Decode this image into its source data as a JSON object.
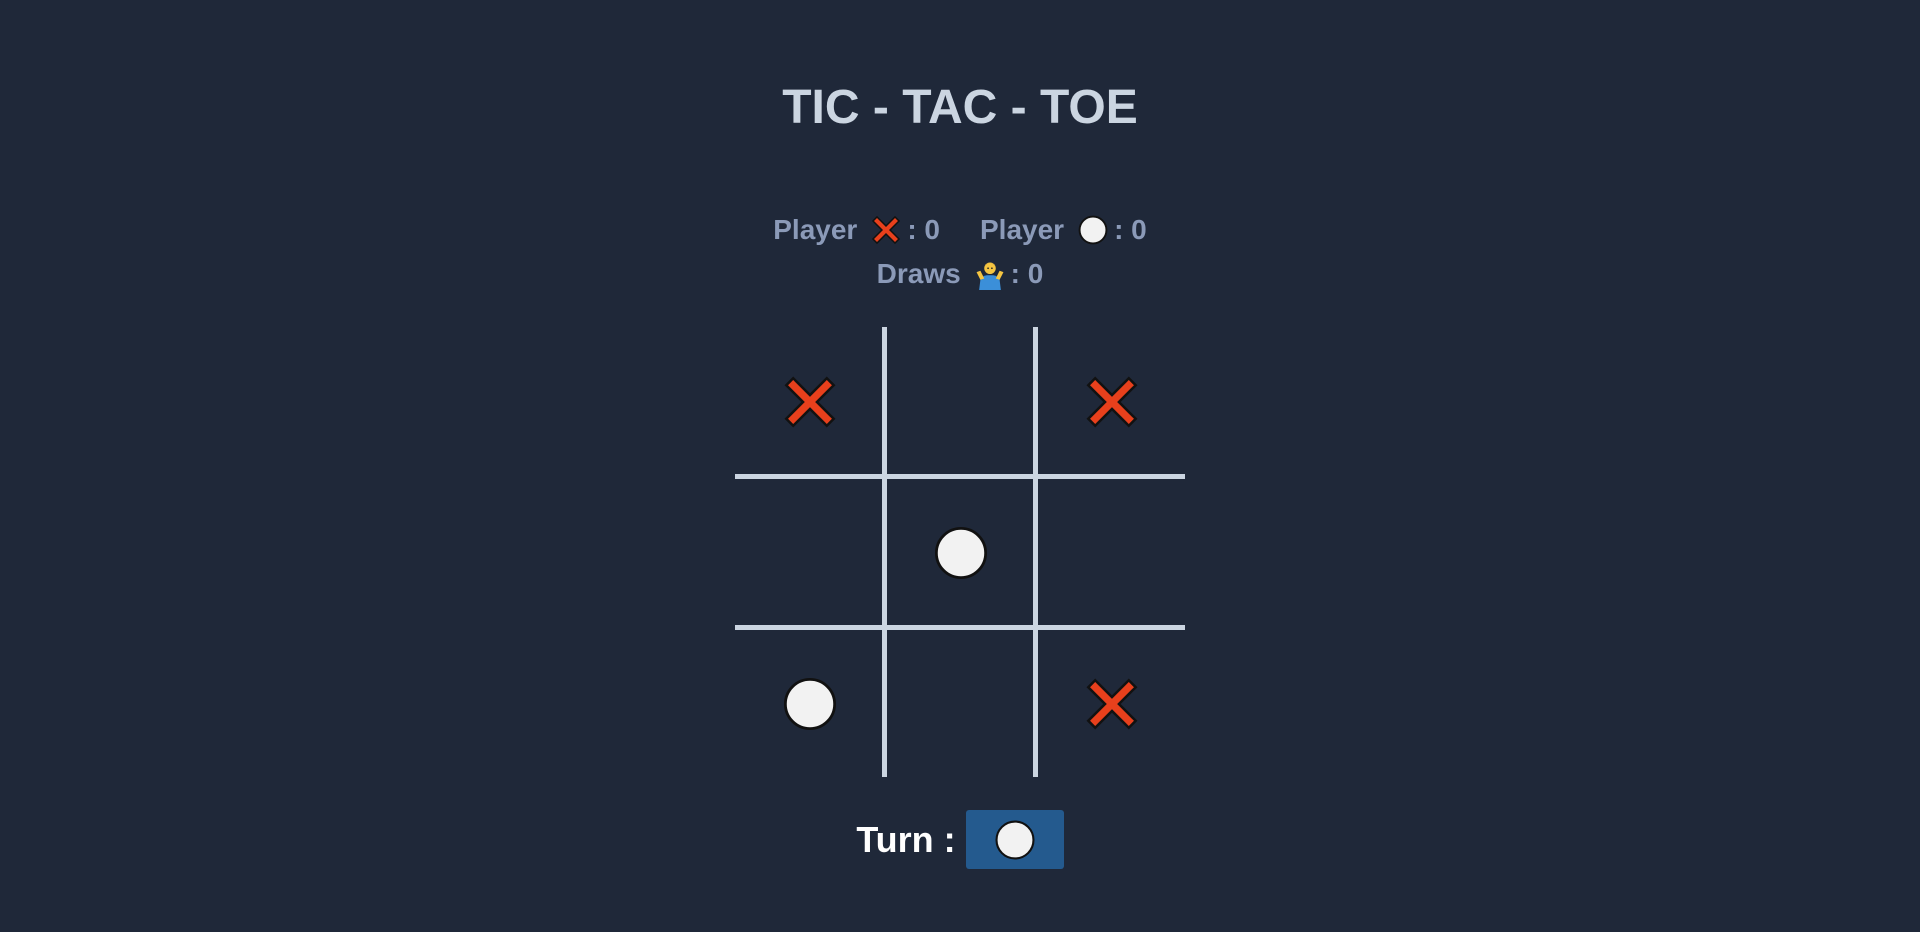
{
  "title": "TIC - TAC - TOE",
  "scores": {
    "player_x_label": "Player",
    "player_x_value": ": 0",
    "player_o_label": "Player",
    "player_o_value": ": 0",
    "draws_label": "Draws",
    "draws_icon": "person-shrugging-icon",
    "draws_value": ": 0"
  },
  "board": {
    "cells": [
      "X",
      "",
      "X",
      "",
      "O",
      "",
      "O",
      "",
      "X"
    ]
  },
  "turn": {
    "label": "Turn :",
    "current": "O"
  },
  "colors": {
    "background": "#1f2839",
    "x_mark": "#e8401c",
    "o_mark": "#f2f2f2",
    "grid": "#cbd5e1",
    "turn_box": "#245a8e"
  }
}
